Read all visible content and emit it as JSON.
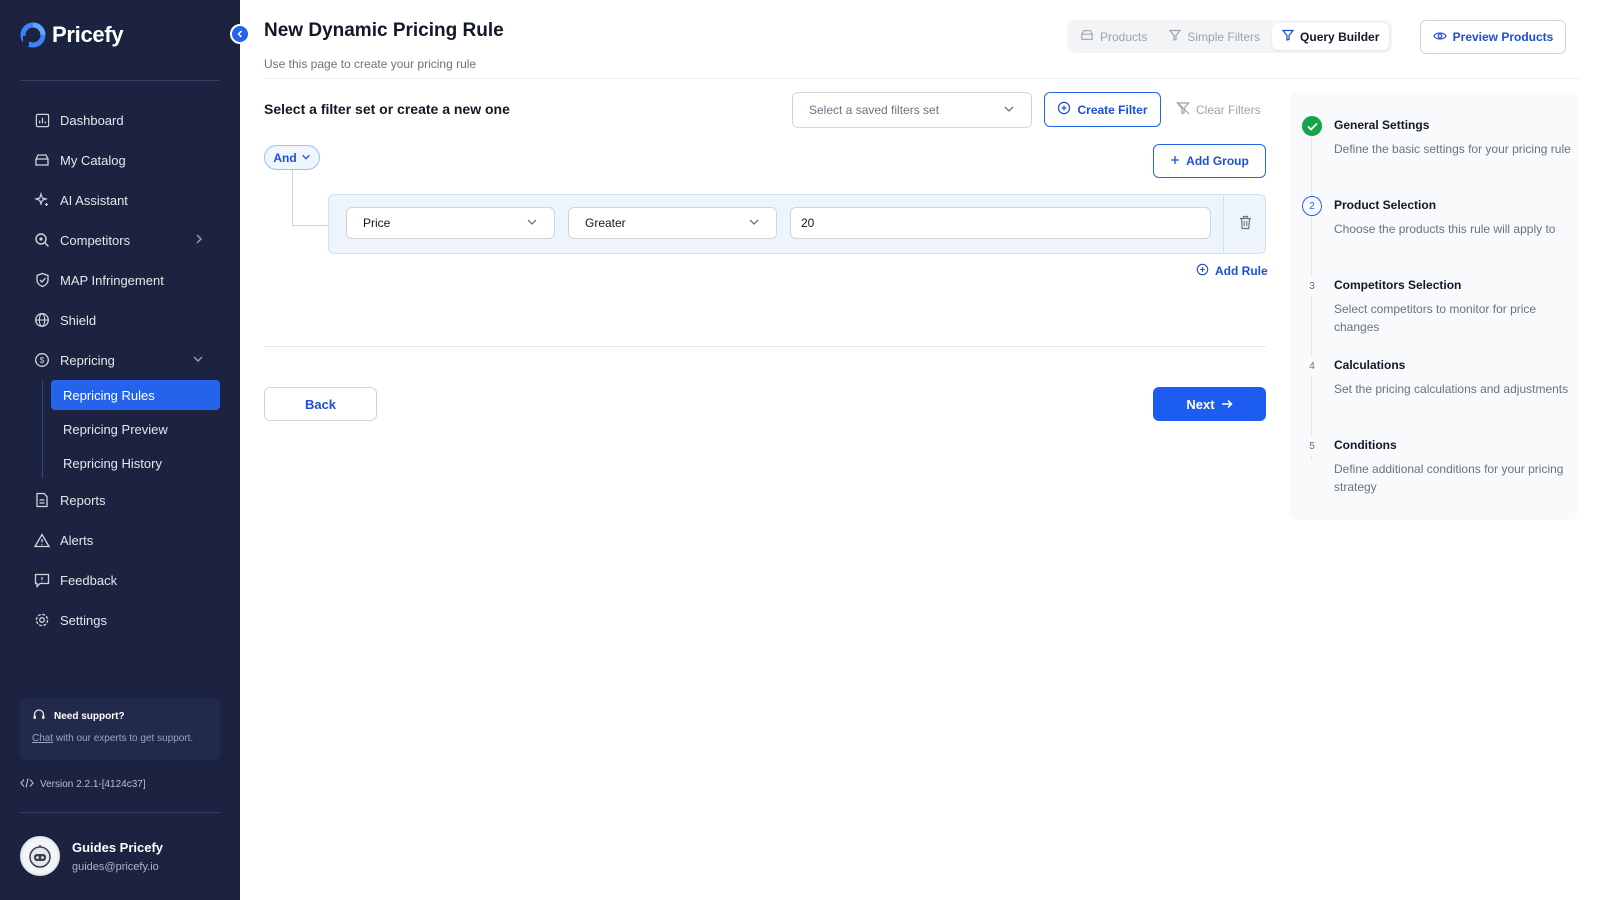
{
  "app": {
    "name": "Pricefy"
  },
  "sidebar": {
    "items": [
      {
        "label": "Dashboard",
        "icon": "dashboard-icon"
      },
      {
        "label": "My Catalog",
        "icon": "catalog-icon"
      },
      {
        "label": "AI Assistant",
        "icon": "sparkle-icon"
      },
      {
        "label": "Competitors",
        "icon": "search-icon"
      },
      {
        "label": "MAP Infringement",
        "icon": "shield-check-icon"
      },
      {
        "label": "Shield",
        "icon": "globe-icon"
      },
      {
        "label": "Repricing",
        "icon": "repricing-icon"
      },
      {
        "label": "Reports",
        "icon": "document-icon"
      },
      {
        "label": "Alerts",
        "icon": "warning-icon"
      },
      {
        "label": "Feedback",
        "icon": "message-icon"
      },
      {
        "label": "Settings",
        "icon": "gear-icon"
      }
    ],
    "repricing_sub": [
      {
        "label": "Repricing Rules",
        "active": true
      },
      {
        "label": "Repricing Preview",
        "active": false
      },
      {
        "label": "Repricing History",
        "active": false
      }
    ],
    "support": {
      "title": "Need support?",
      "link": "Chat",
      "text": " with our experts to get support."
    },
    "version": "Version 2.2.1-[4124c37]",
    "user": {
      "name": "Guides Pricefy",
      "email": "guides@pricefy.io"
    }
  },
  "header": {
    "title": "New Dynamic Pricing Rule",
    "subtitle": "Use this page to create your pricing rule",
    "tabs": [
      {
        "label": "Products",
        "active": false
      },
      {
        "label": "Simple Filters",
        "active": false
      },
      {
        "label": "Query Builder",
        "active": true
      }
    ],
    "preview_label": "Preview Products"
  },
  "filters": {
    "heading": "Select a filter set or create a new one",
    "saved_placeholder": "Select a saved filters set",
    "create_label": "Create Filter",
    "clear_label": "Clear Filters",
    "combinator": "And",
    "add_group_label": "Add Group",
    "rule": {
      "field": "Price",
      "operator": "Greater",
      "value": "20"
    },
    "add_rule_label": "Add Rule"
  },
  "actions": {
    "back": "Back",
    "next": "Next"
  },
  "steps": [
    {
      "number": "1",
      "title": "General Settings",
      "desc": "Define the basic settings for your pricing rule",
      "state": "done"
    },
    {
      "number": "2",
      "title": "Product Selection",
      "desc": "Choose the products this rule will apply to",
      "state": "current"
    },
    {
      "number": "3",
      "title": "Competitors Selection",
      "desc": "Select competitors to monitor for price changes",
      "state": "pending"
    },
    {
      "number": "4",
      "title": "Calculations",
      "desc": "Set the pricing calculations and adjustments",
      "state": "pending"
    },
    {
      "number": "5",
      "title": "Conditions",
      "desc": "Define additional conditions for your pricing strategy",
      "state": "pending"
    }
  ],
  "colors": {
    "sidebar_bg": "#1c2340",
    "accent": "#2563eb",
    "success": "#16a34a"
  }
}
